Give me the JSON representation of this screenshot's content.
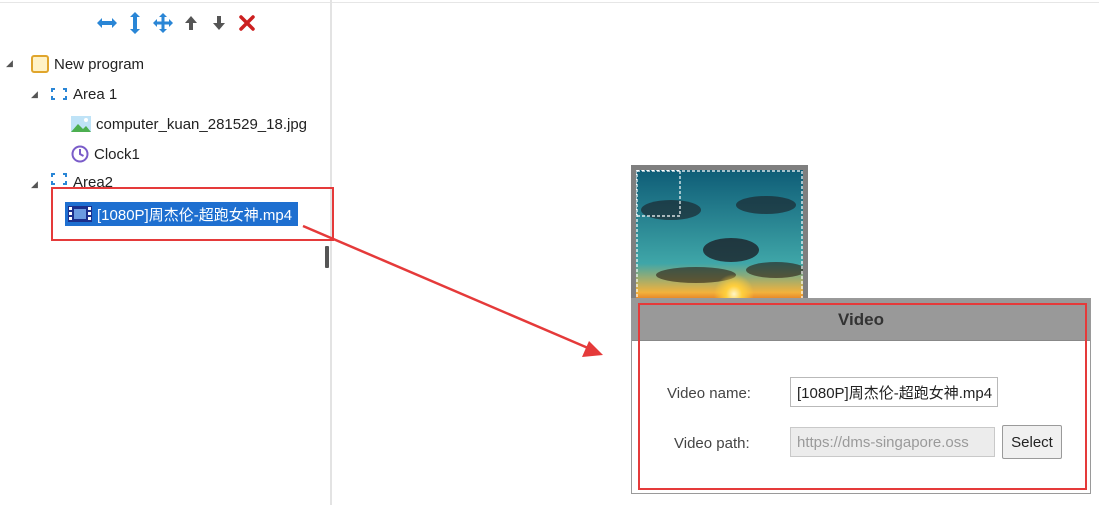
{
  "toolbar": {
    "buttons": [
      {
        "icon": "horizontal-resize-icon",
        "color": "#2a86d6"
      },
      {
        "icon": "vertical-resize-icon",
        "color": "#2a86d6"
      },
      {
        "icon": "move-icon",
        "color": "#2a86d6"
      },
      {
        "icon": "move-up-icon",
        "color": "#555555"
      },
      {
        "icon": "move-down-icon",
        "color": "#555555"
      },
      {
        "icon": "delete-icon",
        "color": "#cc1f1f"
      }
    ]
  },
  "tree": {
    "program": {
      "label": "New program",
      "icon": "program-icon",
      "expanded": true
    },
    "area1": {
      "label": "Area 1",
      "icon": "area-icon",
      "expanded": true
    },
    "image_item": {
      "label": "computer_kuan_281529_18.jpg",
      "icon": "image-icon"
    },
    "clock_item": {
      "label": "Clock1",
      "icon": "clock-icon"
    },
    "area2": {
      "label": "Area2",
      "icon": "area-icon",
      "expanded": true
    },
    "video_item": {
      "label": "[1080P]周杰伦-超跑女神.mp4",
      "icon": "video-icon",
      "selected": true
    }
  },
  "dialog": {
    "title": "Video",
    "video_name_label": "Video name:",
    "video_name_value": "[1080P]周杰伦-超跑女神.mp4",
    "video_path_label": "Video path:",
    "video_path_placeholder": "https://dms-singapore.oss",
    "select_label": "Select"
  },
  "colors": {
    "selection": "#1e6fd0",
    "annotation": "#e53a3a",
    "dialog_header": "#999999"
  }
}
